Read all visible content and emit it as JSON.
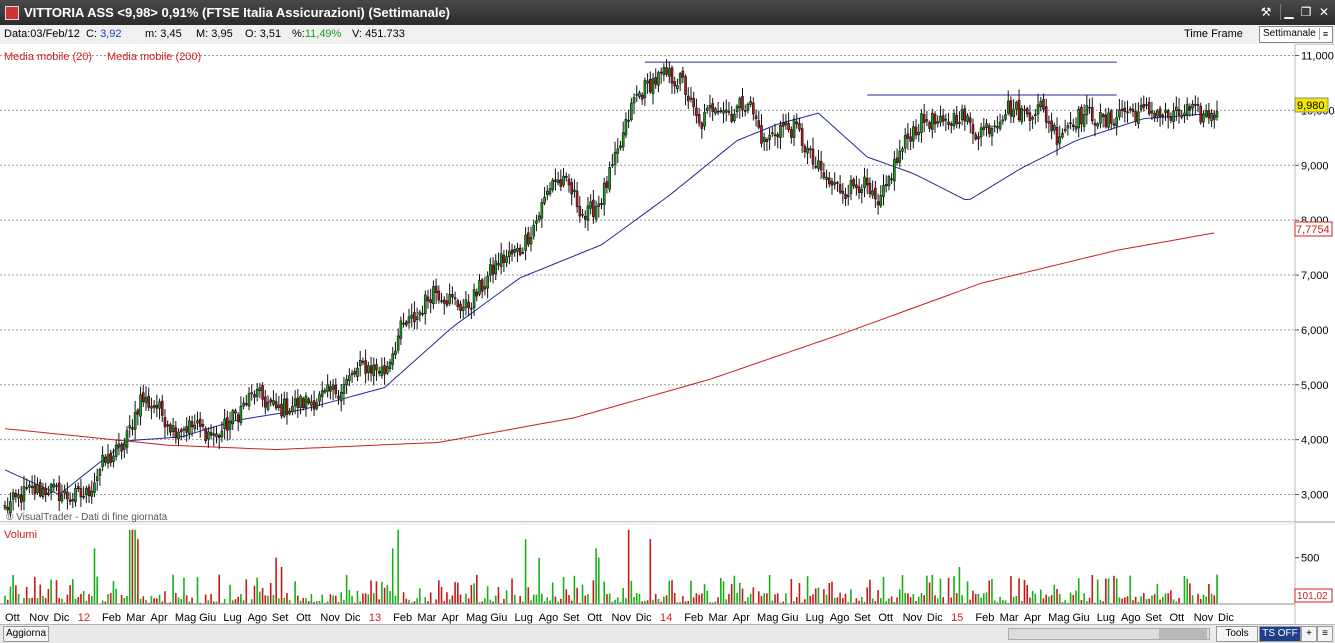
{
  "window": {
    "title": "VITTORIA ASS <9,98> 0,91%  (FTSE Italia Assicurazioni)  (Settimanale)",
    "buttons": [
      "⚒",
      "▁",
      "❐",
      "✕"
    ]
  },
  "info": {
    "data_label": "Data:",
    "data_value": "03/Feb/12",
    "c_label": "C:",
    "c_value": "3,92",
    "m_label": "m:",
    "m_value": "3,45",
    "M_label": "M:",
    "M_value": "3,95",
    "O_label": "O:",
    "O_value": "3,51",
    "pct_label": "%:",
    "pct_value": "11,49%",
    "V_label": "V:",
    "V_value": "451.733",
    "timeframe_label": "Time Frame",
    "timeframe_value": "Settimanale"
  },
  "legend": {
    "ma20": "Media mobile (20)",
    "ma200": "Media mobile (200)",
    "credit": "© VisualTrader - Dati di fine giornata",
    "volume_title": "Volumi"
  },
  "price_axis": {
    "ticks": [
      "11,000",
      "10,000",
      "9,000",
      "8,000",
      "7,000",
      "6,000",
      "5,000",
      "4,000",
      "3,000"
    ],
    "current_price_label": "9,980",
    "ma200_label": "7,7754"
  },
  "volume_axis": {
    "ticks": [
      "500"
    ],
    "current_label": "101,02"
  },
  "x_axis_labels": [
    "Ott",
    "Nov",
    "Dic",
    "12",
    "Feb",
    "Mar",
    "Apr",
    "Mag",
    "Giu",
    "Lug",
    "Ago",
    "Set",
    "Ott",
    "Nov",
    "Dic",
    "13",
    "Feb",
    "Mar",
    "Apr",
    "Mag",
    "Giu",
    "Lug",
    "Ago",
    "Set",
    "Ott",
    "Nov",
    "Dic",
    "14",
    "Feb",
    "Mar",
    "Apr",
    "Mag",
    "Giu",
    "Lug",
    "Ago",
    "Set",
    "Ott",
    "Nov",
    "Dic",
    "15",
    "Feb",
    "Mar",
    "Apr",
    "Mag",
    "Giu",
    "Lug",
    "Ago",
    "Set",
    "Ott",
    "Nov",
    "Dic"
  ],
  "year_labels": [
    "12",
    "13",
    "14",
    "15"
  ],
  "bottom": {
    "refresh_button": "Aggiorna",
    "tools_button": "Tools",
    "ts_button": "TS OFF",
    "plus_button": "+",
    "menu_button": "≡"
  },
  "colors": {
    "up": "#18b018",
    "down": "#c81818",
    "ma20": "#1f2a9a",
    "ma200": "#cc1f1f",
    "resistance": "#1f2a9a",
    "price_highlight": "#f5e800"
  },
  "chart_data": {
    "type": "candlestick",
    "title": "VITTORIA ASS <9,98> 0,91%  (FTSE Italia Assicurazioni)  (Settimanale)",
    "ylim": [
      2.5,
      11.1
    ],
    "yscale": "linear",
    "grid": true,
    "period": "weekly",
    "series": [
      {
        "name": "Media mobile (20)",
        "anchors": [
          [
            0,
            3.45
          ],
          [
            20,
            3.0
          ],
          [
            45,
            3.98
          ],
          [
            65,
            4.05
          ],
          [
            85,
            4.35
          ],
          [
            110,
            4.55
          ],
          [
            140,
            4.95
          ],
          [
            165,
            6.05
          ],
          [
            190,
            6.95
          ],
          [
            220,
            7.55
          ],
          [
            245,
            8.45
          ],
          [
            260,
            9.05
          ],
          [
            270,
            9.45
          ],
          [
            285,
            9.75
          ],
          [
            300,
            9.95
          ],
          [
            318,
            9.15
          ],
          [
            335,
            8.85
          ],
          [
            355,
            8.35
          ],
          [
            375,
            8.95
          ],
          [
            395,
            9.45
          ],
          [
            420,
            9.85
          ],
          [
            447,
            9.95
          ]
        ]
      },
      {
        "name": "Media mobile (200)",
        "anchors": [
          [
            0,
            4.2
          ],
          [
            60,
            3.9
          ],
          [
            100,
            3.82
          ],
          [
            160,
            3.95
          ],
          [
            210,
            4.4
          ],
          [
            260,
            5.1
          ],
          [
            310,
            5.95
          ],
          [
            360,
            6.85
          ],
          [
            410,
            7.45
          ],
          [
            447,
            7.7754
          ]
        ]
      }
    ],
    "candle_anchors": [
      [
        0,
        2.75
      ],
      [
        8,
        3.05
      ],
      [
        16,
        3.1
      ],
      [
        24,
        2.95
      ],
      [
        30,
        3.0
      ],
      [
        36,
        3.55
      ],
      [
        44,
        3.9
      ],
      [
        50,
        4.75
      ],
      [
        56,
        4.6
      ],
      [
        62,
        4.2
      ],
      [
        70,
        4.25
      ],
      [
        78,
        4.05
      ],
      [
        86,
        4.5
      ],
      [
        92,
        4.85
      ],
      [
        100,
        4.55
      ],
      [
        108,
        4.65
      ],
      [
        116,
        4.75
      ],
      [
        124,
        4.95
      ],
      [
        132,
        5.35
      ],
      [
        140,
        5.25
      ],
      [
        146,
        6.0
      ],
      [
        152,
        6.25
      ],
      [
        158,
        6.75
      ],
      [
        164,
        6.55
      ],
      [
        170,
        6.4
      ],
      [
        176,
        6.8
      ],
      [
        182,
        7.25
      ],
      [
        190,
        7.45
      ],
      [
        196,
        8.0
      ],
      [
        202,
        8.75
      ],
      [
        208,
        8.6
      ],
      [
        214,
        8.05
      ],
      [
        220,
        8.4
      ],
      [
        226,
        9.2
      ],
      [
        232,
        10.2
      ],
      [
        238,
        10.5
      ],
      [
        244,
        10.65
      ],
      [
        250,
        10.5
      ],
      [
        256,
        9.7
      ],
      [
        262,
        10.15
      ],
      [
        268,
        9.95
      ],
      [
        274,
        10.2
      ],
      [
        280,
        9.4
      ],
      [
        286,
        9.7
      ],
      [
        292,
        9.65
      ],
      [
        298,
        9.05
      ],
      [
        304,
        8.65
      ],
      [
        310,
        8.55
      ],
      [
        316,
        8.7
      ],
      [
        322,
        8.2
      ],
      [
        328,
        9.0
      ],
      [
        334,
        9.6
      ],
      [
        340,
        9.85
      ],
      [
        346,
        9.7
      ],
      [
        352,
        9.95
      ],
      [
        358,
        9.6
      ],
      [
        364,
        9.75
      ],
      [
        370,
        10.05
      ],
      [
        376,
        9.95
      ],
      [
        382,
        10.05
      ],
      [
        388,
        9.55
      ],
      [
        394,
        9.85
      ],
      [
        400,
        9.95
      ],
      [
        406,
        9.75
      ],
      [
        412,
        10.0
      ],
      [
        418,
        9.95
      ],
      [
        424,
        10.0
      ],
      [
        430,
        9.85
      ],
      [
        436,
        10.0
      ],
      [
        442,
        9.9
      ],
      [
        447,
        9.98
      ]
    ],
    "volume_big": [
      [
        33,
        6
      ],
      [
        46,
        8
      ],
      [
        47,
        8
      ],
      [
        48,
        8
      ],
      [
        49,
        7
      ],
      [
        100,
        5
      ],
      [
        102,
        4
      ],
      [
        143,
        6
      ],
      [
        145,
        8
      ],
      [
        192,
        7
      ],
      [
        197,
        5
      ],
      [
        218,
        6
      ],
      [
        219,
        5
      ],
      [
        230,
        8
      ],
      [
        238,
        7
      ],
      [
        352,
        4
      ]
    ],
    "resistance_lines": [
      [
        236,
        10.88,
        410,
        10.88
      ],
      [
        318,
        10.28,
        410,
        10.28
      ]
    ]
  }
}
